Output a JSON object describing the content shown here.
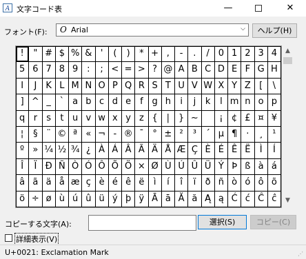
{
  "window": {
    "title": "文字コード表",
    "minimize": "—",
    "close": "✕"
  },
  "font": {
    "label": "フォント(F):",
    "icon": "O",
    "selected": "Arial",
    "dropdown_arrow": "⌵",
    "help_button": "ヘルプ(H)"
  },
  "grid": {
    "rows": [
      [
        "!",
        "\"",
        "#",
        "$",
        "%",
        "&",
        "'",
        "(",
        ")",
        "*",
        "+",
        ",",
        "-",
        ".",
        "/",
        "0",
        "1",
        "2",
        "3",
        "4"
      ],
      [
        "5",
        "6",
        "7",
        "8",
        "9",
        ":",
        ";",
        "<",
        "=",
        ">",
        "?",
        "@",
        "A",
        "B",
        "C",
        "D",
        "E",
        "F",
        "G",
        "H"
      ],
      [
        "I",
        "J",
        "K",
        "L",
        "M",
        "N",
        "O",
        "P",
        "Q",
        "R",
        "S",
        "T",
        "U",
        "V",
        "W",
        "X",
        "Y",
        "Z",
        "[",
        "\\"
      ],
      [
        "]",
        "^",
        "_",
        "`",
        "a",
        "b",
        "c",
        "d",
        "e",
        "f",
        "g",
        "h",
        "i",
        "j",
        "k",
        "l",
        "m",
        "n",
        "o",
        "p"
      ],
      [
        "q",
        "r",
        "s",
        "t",
        "u",
        "v",
        "w",
        "x",
        "y",
        "z",
        "{",
        "|",
        "}",
        "~",
        "",
        "¡",
        "¢",
        "£",
        "¤",
        "¥"
      ],
      [
        "¦",
        "§",
        "¨",
        "©",
        "ª",
        "«",
        "¬",
        "-",
        "®",
        "¯",
        "°",
        "±",
        "²",
        "³",
        "´",
        "µ",
        "¶",
        "·",
        "¸",
        "¹"
      ],
      [
        "º",
        "»",
        "¼",
        "½",
        "¾",
        "¿",
        "À",
        "Á",
        "Â",
        "Ã",
        "Ä",
        "Å",
        "Æ",
        "Ç",
        "È",
        "É",
        "Ê",
        "Ë",
        "Ì",
        "Í"
      ],
      [
        "Î",
        "Ï",
        "Ð",
        "Ñ",
        "Ò",
        "Ó",
        "Ô",
        "Õ",
        "Ö",
        "×",
        "Ø",
        "Ù",
        "Ú",
        "Û",
        "Ü",
        "Ý",
        "Þ",
        "ß",
        "à",
        "á"
      ],
      [
        "â",
        "ã",
        "ä",
        "å",
        "æ",
        "ç",
        "è",
        "é",
        "ê",
        "ë",
        "ì",
        "í",
        "î",
        "ï",
        "ð",
        "ñ",
        "ò",
        "ó",
        "ô",
        "õ"
      ],
      [
        "ö",
        "÷",
        "ø",
        "ù",
        "ú",
        "û",
        "ü",
        "ý",
        "þ",
        "ÿ",
        "Ā",
        "ā",
        "Ă",
        "ă",
        "Ą",
        "ą",
        "Ć",
        "ć",
        "Ĉ",
        "ĉ"
      ]
    ],
    "selected_row": 0,
    "selected_col": 0
  },
  "scrollbar": {
    "up_arrow": "▲",
    "down_arrow": "▼"
  },
  "copy": {
    "label": "コピーする文字(A):",
    "value": "",
    "select_button": "選択(S)",
    "copy_button": "コピー(C)"
  },
  "advanced": {
    "label": "詳細表示(V)",
    "checked": false
  },
  "status": {
    "text": "U+0021: Exclamation Mark"
  }
}
